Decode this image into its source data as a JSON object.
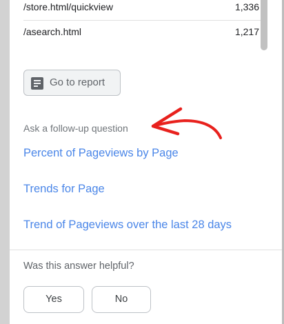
{
  "table": {
    "rows": [
      {
        "path": "/store.html/quickview",
        "count": "1,336"
      },
      {
        "path": "/asearch.html",
        "count": "1,217"
      }
    ]
  },
  "report_button": {
    "label": "Go to report",
    "icon": "report-icon"
  },
  "followup": {
    "heading": "Ask a follow-up question",
    "links": [
      "Percent of Pageviews by Page",
      "Trends for Page",
      "Trend of Pageviews over the last 28 days"
    ]
  },
  "feedback": {
    "question": "Was this answer helpful?",
    "yes_label": "Yes",
    "no_label": "No"
  },
  "annotation": {
    "icon": "red-arrow-annotation",
    "color": "#e8211d"
  },
  "colors": {
    "link": "#4a86e8",
    "text": "#202124",
    "muted": "#70757a"
  }
}
